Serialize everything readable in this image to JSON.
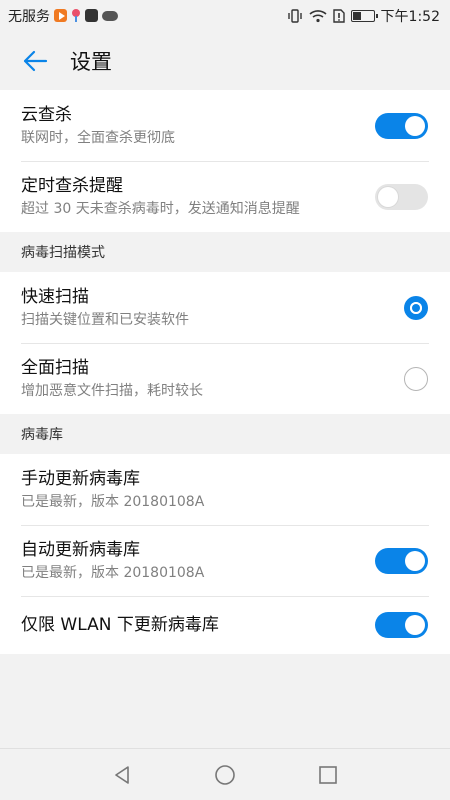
{
  "status_bar": {
    "carrier": "无服务",
    "time": "下午1:52"
  },
  "header": {
    "title": "设置",
    "back_icon": "arrow-left-icon"
  },
  "cards": [
    {
      "rows": [
        {
          "title": "云查杀",
          "subtitle": "联网时，全面查杀更彻底",
          "control": "toggle",
          "on": true
        },
        {
          "title": "定时查杀提醒",
          "subtitle": "超过 30 天未查杀病毒时，发送通知消息提醒",
          "control": "toggle",
          "on": false
        }
      ]
    }
  ],
  "sections": {
    "scan_mode": {
      "header": "病毒扫描模式",
      "rows": [
        {
          "title": "快速扫描",
          "subtitle": "扫描关键位置和已安装软件",
          "control": "radio",
          "selected": true
        },
        {
          "title": "全面扫描",
          "subtitle": "增加恶意文件扫描，耗时较长",
          "control": "radio",
          "selected": false
        }
      ]
    },
    "virus_db": {
      "header": "病毒库",
      "rows": [
        {
          "title": "手动更新病毒库",
          "subtitle": "已是最新，版本 20180108A",
          "control": "none"
        },
        {
          "title": "自动更新病毒库",
          "subtitle": "已是最新，版本 20180108A",
          "control": "toggle",
          "on": true
        },
        {
          "title": "仅限 WLAN 下更新病毒库",
          "control": "toggle",
          "on": true
        }
      ]
    }
  },
  "colors": {
    "accent": "#0a84e8",
    "background": "#f2f2f2",
    "card": "#ffffff",
    "subtitle": "#808080"
  },
  "nav_bar": {
    "icons": [
      "back-triangle-icon",
      "home-circle-icon",
      "recents-square-icon"
    ]
  }
}
